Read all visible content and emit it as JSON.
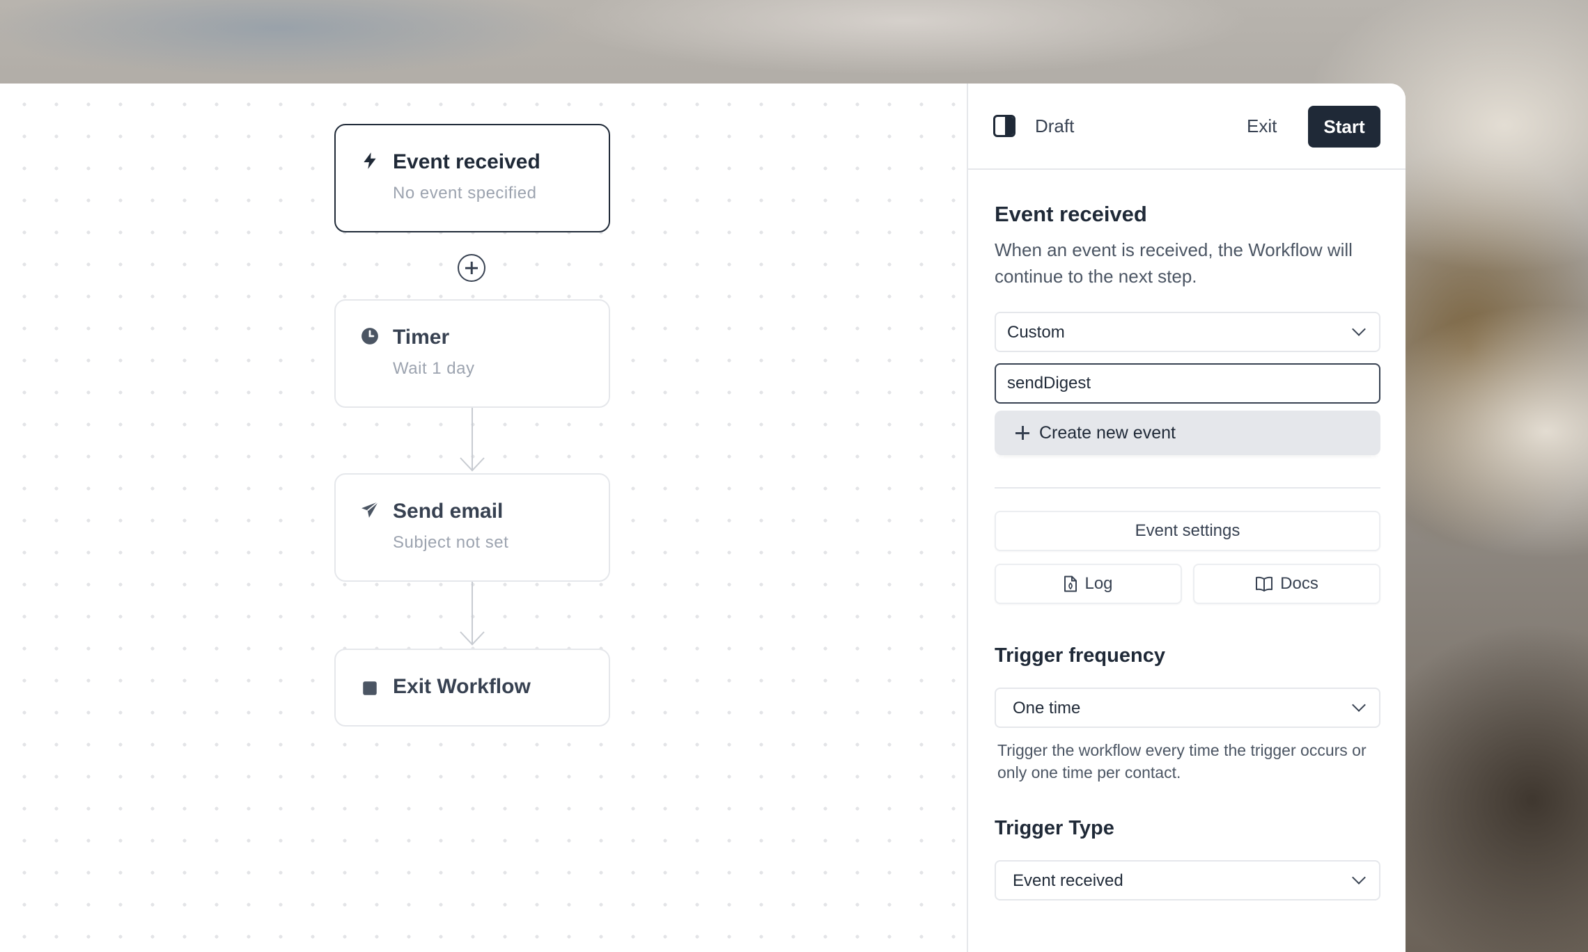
{
  "workflow": {
    "nodes": [
      {
        "title": "Event received",
        "subtitle": "No event specified",
        "icon": "lightning-icon",
        "selected": true
      },
      {
        "title": "Timer",
        "subtitle": "Wait 1 day",
        "icon": "clock-icon"
      },
      {
        "title": "Send email",
        "subtitle": "Subject not set",
        "icon": "paper-plane-icon"
      },
      {
        "title": "Exit Workflow",
        "subtitle": "",
        "icon": "stop-square-icon"
      }
    ]
  },
  "header": {
    "status": "Draft",
    "exit_label": "Exit",
    "start_label": "Start"
  },
  "panel": {
    "title": "Event received",
    "description": "When an event is received, the Workflow will continue to the next step.",
    "event_type": "Custom",
    "event_input_value": "sendDigest",
    "create_option": "Create new event",
    "event_settings_label": "Event settings",
    "log_label": "Log",
    "docs_label": "Docs",
    "trigger_frequency": {
      "title": "Trigger frequency",
      "value": "One time",
      "help": "Trigger the workflow every time the trigger occurs or only one time per contact."
    },
    "trigger_type": {
      "title": "Trigger Type",
      "value": "Event received"
    }
  },
  "colors": {
    "primary": "#1f2937",
    "border": "#e5e7eb",
    "muted_text": "#9ca3af"
  }
}
